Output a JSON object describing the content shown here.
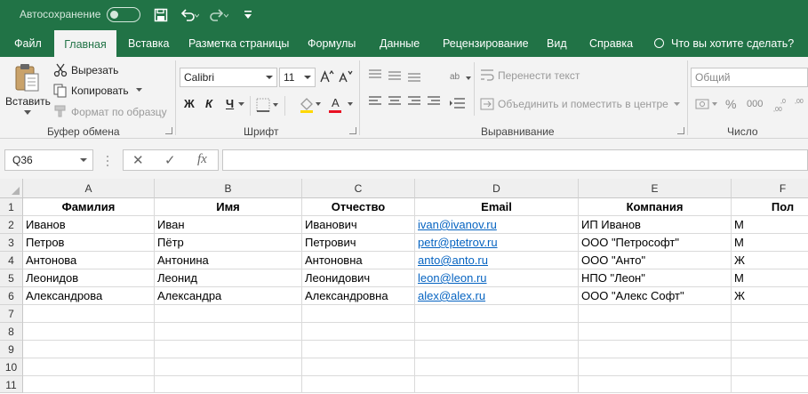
{
  "titlebar": {
    "autosave_label": "Автосохранение",
    "save_icon": "save-icon",
    "undo_icon": "undo-icon",
    "redo_icon": "redo-icon"
  },
  "tabs": [
    {
      "label": "Файл",
      "active": false
    },
    {
      "label": "Главная",
      "active": true
    },
    {
      "label": "Вставка",
      "active": false
    },
    {
      "label": "Разметка страницы",
      "active": false
    },
    {
      "label": "Формулы",
      "active": false
    },
    {
      "label": "Данные",
      "active": false
    },
    {
      "label": "Рецензирование",
      "active": false
    },
    {
      "label": "Вид",
      "active": false
    },
    {
      "label": "Справка",
      "active": false
    }
  ],
  "tell_me": "Что вы хотите сделать?",
  "ribbon": {
    "clipboard": {
      "paste": "Вставить",
      "cut": "Вырезать",
      "copy": "Копировать",
      "format_painter": "Формат по образцу",
      "group_label": "Буфер обмена"
    },
    "font": {
      "font_name": "Calibri",
      "font_size": "11",
      "bold": "Ж",
      "italic": "К",
      "underline": "Ч",
      "font_color_letter": "А",
      "group_label": "Шрифт",
      "font_color": "#e81123",
      "fill_color": "#ffd800"
    },
    "alignment": {
      "wrap_text": "Перенести текст",
      "merge_center": "Объединить и поместить в центре",
      "group_label": "Выравнивание"
    },
    "number": {
      "format": "Общий",
      "percent": "%",
      "comma": "000",
      "group_label": "Число"
    }
  },
  "formula_bar": {
    "name_box": "Q36",
    "cancel": "✕",
    "enter": "✓",
    "fx": "fx",
    "content": ""
  },
  "sheet": {
    "columns": [
      "A",
      "B",
      "C",
      "D",
      "E",
      "F"
    ],
    "row_numbers": [
      "1",
      "2",
      "3",
      "4",
      "5",
      "6",
      "7",
      "8",
      "9",
      "10",
      "11"
    ],
    "headers": [
      "Фамилия",
      "Имя",
      "Отчество",
      "Email",
      "Компания",
      "Пол"
    ],
    "rows": [
      [
        "Иванов",
        "Иван",
        "Иванович",
        "ivan@ivanov.ru",
        "ИП Иванов",
        "М"
      ],
      [
        "Петров",
        "Пётр",
        "Петрович",
        "petr@ptetrov.ru",
        "ООО \"Петрософт\"",
        "М"
      ],
      [
        "Антонова",
        "Антонина",
        "Антоновна",
        "anto@anto.ru",
        "ООО \"Анто\"",
        "Ж"
      ],
      [
        "Леонидов",
        "Леонид",
        "Леонидович",
        "leon@leon.ru",
        "НПО \"Леон\"",
        "М"
      ],
      [
        "Александрова",
        "Александра",
        "Александровна",
        "alex@alex.ru",
        "ООО \"Алекс Софт\"",
        "Ж"
      ]
    ],
    "accent_color": "#217346",
    "link_color": "#0563c1"
  }
}
